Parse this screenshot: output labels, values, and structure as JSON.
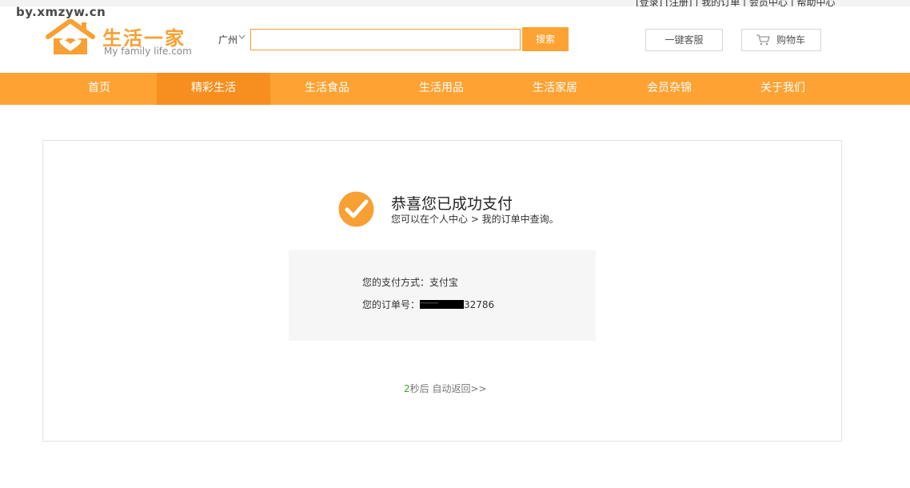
{
  "watermark": "by.xmzyw.cn",
  "topbar": {
    "links_text": "[登录] [注册] | 我的订单 | 会员中心 | 帮助中心"
  },
  "logo": {
    "cn": "生活一家",
    "en": "My family life.com"
  },
  "header": {
    "city": "广州",
    "search_placeholder": "",
    "search_label": "搜索",
    "service_label": "一键客服",
    "cart_label": "购物车"
  },
  "nav": {
    "items": [
      {
        "label": "首页"
      },
      {
        "label": "精彩生活"
      },
      {
        "label": "生活食品"
      },
      {
        "label": "生活用品"
      },
      {
        "label": "生活家居"
      },
      {
        "label": "会员杂锦"
      },
      {
        "label": "关于我们"
      }
    ],
    "active_index": 1
  },
  "result": {
    "title": "恭喜您已成功支付",
    "subtitle": "您可以在个人中心 > 我的订单中查询。",
    "payment_label": "您的支付方式：",
    "payment_value": "支付宝",
    "order_label": "您的订单号：",
    "order_redacted": "----------",
    "order_suffix": "32786"
  },
  "countdown": {
    "seconds": "2",
    "text": "秒后 自动返回>>"
  },
  "colors": {
    "brand_orange": "#fea233",
    "nav_active": "#f68f1f",
    "countdown_number": "#4a9e3a"
  }
}
